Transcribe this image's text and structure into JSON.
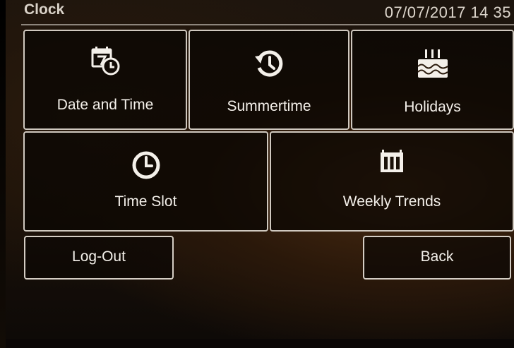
{
  "header": {
    "title": "Clock",
    "datetime": "07/07/2017 14 35"
  },
  "tiles": [
    {
      "label": "Date and Time",
      "icon": "calendar-clock-icon"
    },
    {
      "label": "Summertime",
      "icon": "history-clock-icon"
    },
    {
      "label": "Holidays",
      "icon": "cake-icon"
    },
    {
      "label": "Time Slot",
      "icon": "clock-icon"
    },
    {
      "label": "Weekly Trends",
      "icon": "weekly-columns-icon"
    }
  ],
  "footer": {
    "logout_label": "Log-Out",
    "back_label": "Back"
  },
  "colors": {
    "border": "#cfc8bf",
    "text": "#f4f0ea",
    "background": "#1c140d"
  }
}
